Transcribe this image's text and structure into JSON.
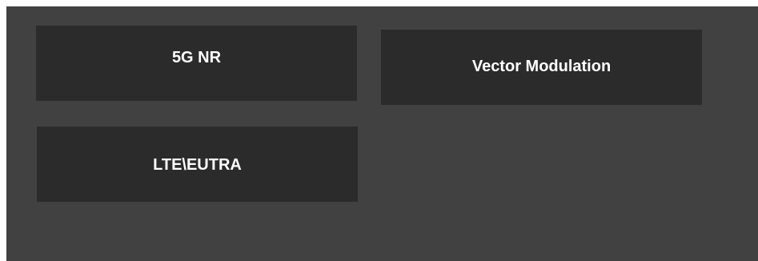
{
  "buttons": {
    "nr_5g": {
      "label": "5G NR"
    },
    "vector_modulation": {
      "label": "Vector Modulation"
    },
    "lte_eutra": {
      "label": "LTE\\EUTRA"
    }
  },
  "colors": {
    "panel_background": "#414141",
    "button_background": "#2b2b2b",
    "button_text": "#ffffff"
  }
}
